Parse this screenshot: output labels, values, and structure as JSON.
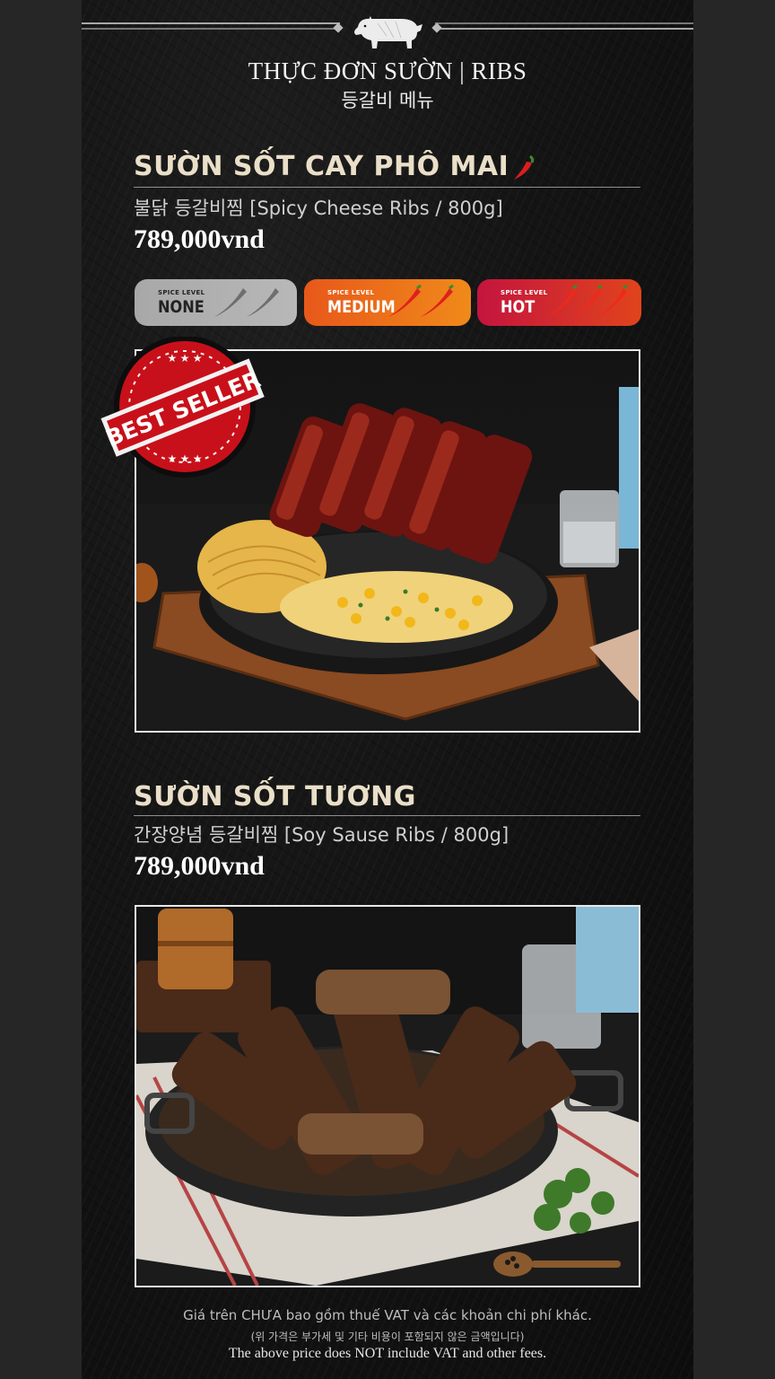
{
  "header": {
    "title": "THỰC ĐƠN SƯỜN | RIBS",
    "title_kr": "등갈비 메뉴",
    "logo_icon": "pig-icon"
  },
  "items": [
    {
      "name": "SƯỜN SỐT CAY PHÔ MAI",
      "subtitle": "불닭 등갈비찜 [Spicy Cheese Ribs / 800g]",
      "price": "789,000vnd",
      "badge": "BEST SELLER",
      "image": "spicy-cheese-ribs-photo"
    },
    {
      "name": "SƯỜN SỐT TƯƠNG",
      "subtitle": "간장양념 등갈비찜 [Soy Sause Ribs / 800g]",
      "price": "789,000vnd",
      "image": "soy-sauce-ribs-photo"
    }
  ],
  "spice_levels": [
    {
      "small": "SPICE LEVEL",
      "label": "NONE",
      "peppers": 2,
      "color": "#b0b0b0"
    },
    {
      "small": "SPICE LEVEL",
      "label": "MEDIUM",
      "peppers": 2,
      "color": "#ec6c1a"
    },
    {
      "small": "SPICE LEVEL",
      "label": "HOT",
      "peppers": 3,
      "color": "#d22a32"
    }
  ],
  "footer": {
    "vn": "Giá trên CHƯA bao gồm thuế VAT và các khoản chi phí khác.",
    "kr": "(위 가격은 부가세 및 기타 비용이 포함되지 않은 금액입니다)",
    "en": "The above price does NOT include VAT and other fees."
  }
}
